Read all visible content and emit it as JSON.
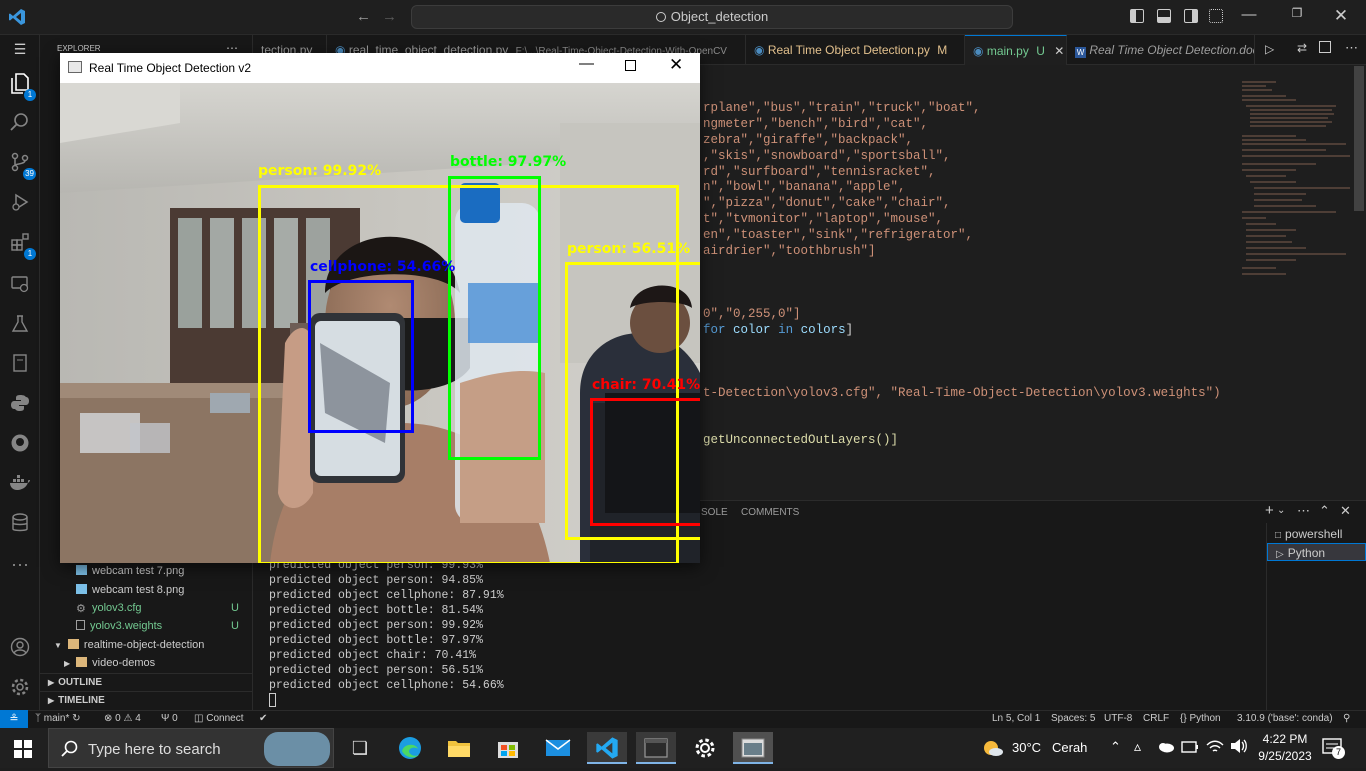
{
  "titlebar": {
    "search_text": "Object_detection"
  },
  "activity_badges": {
    "explorer": "1",
    "source_control": "39",
    "extensions": "1"
  },
  "sidebar": {
    "header": "EXPLORER",
    "items": [
      {
        "label": "webcam test 7.png",
        "badge": "",
        "type": "png"
      },
      {
        "label": "webcam test 8.png",
        "badge": "",
        "type": "png"
      },
      {
        "label": "yolov3.cfg",
        "badge": "U",
        "type": "cfg"
      },
      {
        "label": "yolov3.weights",
        "badge": "U",
        "type": "file"
      }
    ],
    "folder_open": "realtime-object-detection",
    "folder_child": "video-demos",
    "outline": "OUTLINE",
    "timeline": "TIMELINE"
  },
  "tabs": [
    {
      "label": "tection.py"
    },
    {
      "label": "real_time_object_detection.py",
      "desc": "F:\\...\\Real-Time-Object-Detection-With-OpenCV"
    },
    {
      "label": "Real Time Object Detection.py",
      "mod": "M"
    },
    {
      "label": "main.py",
      "mod": "U"
    },
    {
      "label": "Real Time Object Detection.docx"
    }
  ],
  "code": {
    "l1": "rplane\",\"bus\",\"train\",\"truck\",\"boat\",",
    "l2": "ngmeter\",\"bench\",\"bird\",\"cat\",",
    "l3": "zebra\",\"giraffe\",\"backpack\",",
    "l4": ",\"skis\",\"snowboard\",\"sportsball\",",
    "l5": "rd\",\"surfboard\",\"tennisracket\",",
    "l6": "n\",\"bowl\",\"banana\",\"apple\",",
    "l7": "\",\"pizza\",\"donut\",\"cake\",\"chair\",",
    "l8": "t\",\"tvmonitor\",\"laptop\",\"mouse\",",
    "l9": "en\",\"toaster\",\"sink\",\"refrigerator\",",
    "l10": "airdrier\",\"toothbrush\"]",
    "l11_str": "0\",\"0,255,0\"]",
    "l12_kw1": "for",
    "l12_v1": "color",
    "l12_kw2": "in",
    "l12_v2": "colors",
    "l12_end": "]",
    "l13": "t-Detection\\yolov3.cfg\", \"Real-Time-Object-Detection\\yolov3.weights\")",
    "l14": "getUnconnectedOutLayers()]"
  },
  "panel": {
    "tab_console": "SOLE",
    "tab_comments": "COMMENTS",
    "terminal_lines": [
      "predicted object person: 99.93%",
      "predicted object person: 94.85%",
      "predicted object cellphone: 87.91%",
      "predicted object bottle: 81.54%",
      "predicted object person: 99.92%",
      "predicted object bottle: 97.97%",
      "predicted object chair: 70.41%",
      "predicted object person: 56.51%",
      "predicted object cellphone: 54.66%"
    ],
    "terminals": [
      "powershell",
      "Python"
    ]
  },
  "statusbar": {
    "branch": "main*",
    "problems_errors": "0",
    "problems_warnings": "4",
    "ports": "0",
    "connect": "Connect",
    "position": "Ln 5, Col 1",
    "spaces": "Spaces: 5",
    "encoding": "UTF-8",
    "eol": "CRLF",
    "language": "Python",
    "interpreter": "3.10.9 ('base': conda)"
  },
  "cv_window": {
    "title": "Real Time Object Detection v2",
    "detections": [
      {
        "label": "person: 99.92%",
        "color": "#ffff00"
      },
      {
        "label": "bottle: 97.97%",
        "color": "#00ff00"
      },
      {
        "label": "person: 56.51%",
        "color": "#ffff00"
      },
      {
        "label": "cellphone: 54.66%",
        "color": "#0000ff"
      },
      {
        "label": "chair: 70.41%",
        "color": "#ff0000"
      }
    ]
  },
  "taskbar": {
    "search_placeholder": "Type here to search",
    "weather_temp": "30°C",
    "weather_desc": "Cerah",
    "time": "4:22 PM",
    "date": "9/25/2023",
    "notifications": "7"
  },
  "colors": {
    "accent": "#0078d4",
    "editor_bg": "#1e1e1e",
    "string": "#ce9178",
    "keyword": "#569cd6"
  }
}
